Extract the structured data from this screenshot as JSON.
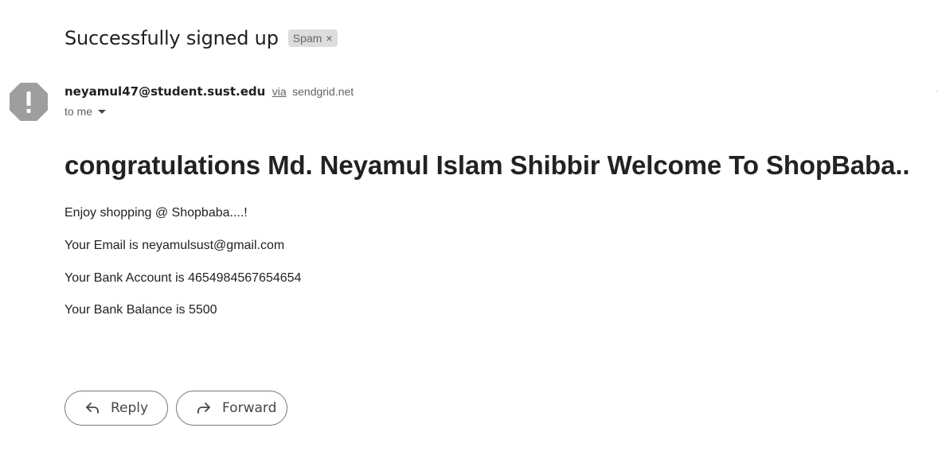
{
  "subject": "Successfully signed up",
  "label": {
    "text": "Spam",
    "remove": "×"
  },
  "sender": {
    "email": "neyamul47@student.sust.edu",
    "via_text": "via",
    "via_domain": "sendgrid.net",
    "avatar_icon": "warning-octagon-icon"
  },
  "recipient": {
    "text": "to me",
    "dropdown_icon": "caret-down-icon"
  },
  "message": {
    "heading": "congratulations Md. Neyamul Islam Shibbir Welcome To ShopBaba..",
    "lines": [
      "Enjoy shopping @ Shopbaba....!",
      "Your Email is neyamulsust@gmail.com",
      "Your Bank Account is 4654984567654654",
      "Your Bank Balance is 5500"
    ]
  },
  "actions": {
    "reply_label": "Reply",
    "reply_icon": "reply-arrow-icon",
    "forward_label": "Forward",
    "forward_icon": "forward-arrow-icon"
  },
  "colors": {
    "spam_chip_bg": "#dddddd",
    "avatar_bg": "#9e9e9e",
    "button_border": "#747775"
  }
}
